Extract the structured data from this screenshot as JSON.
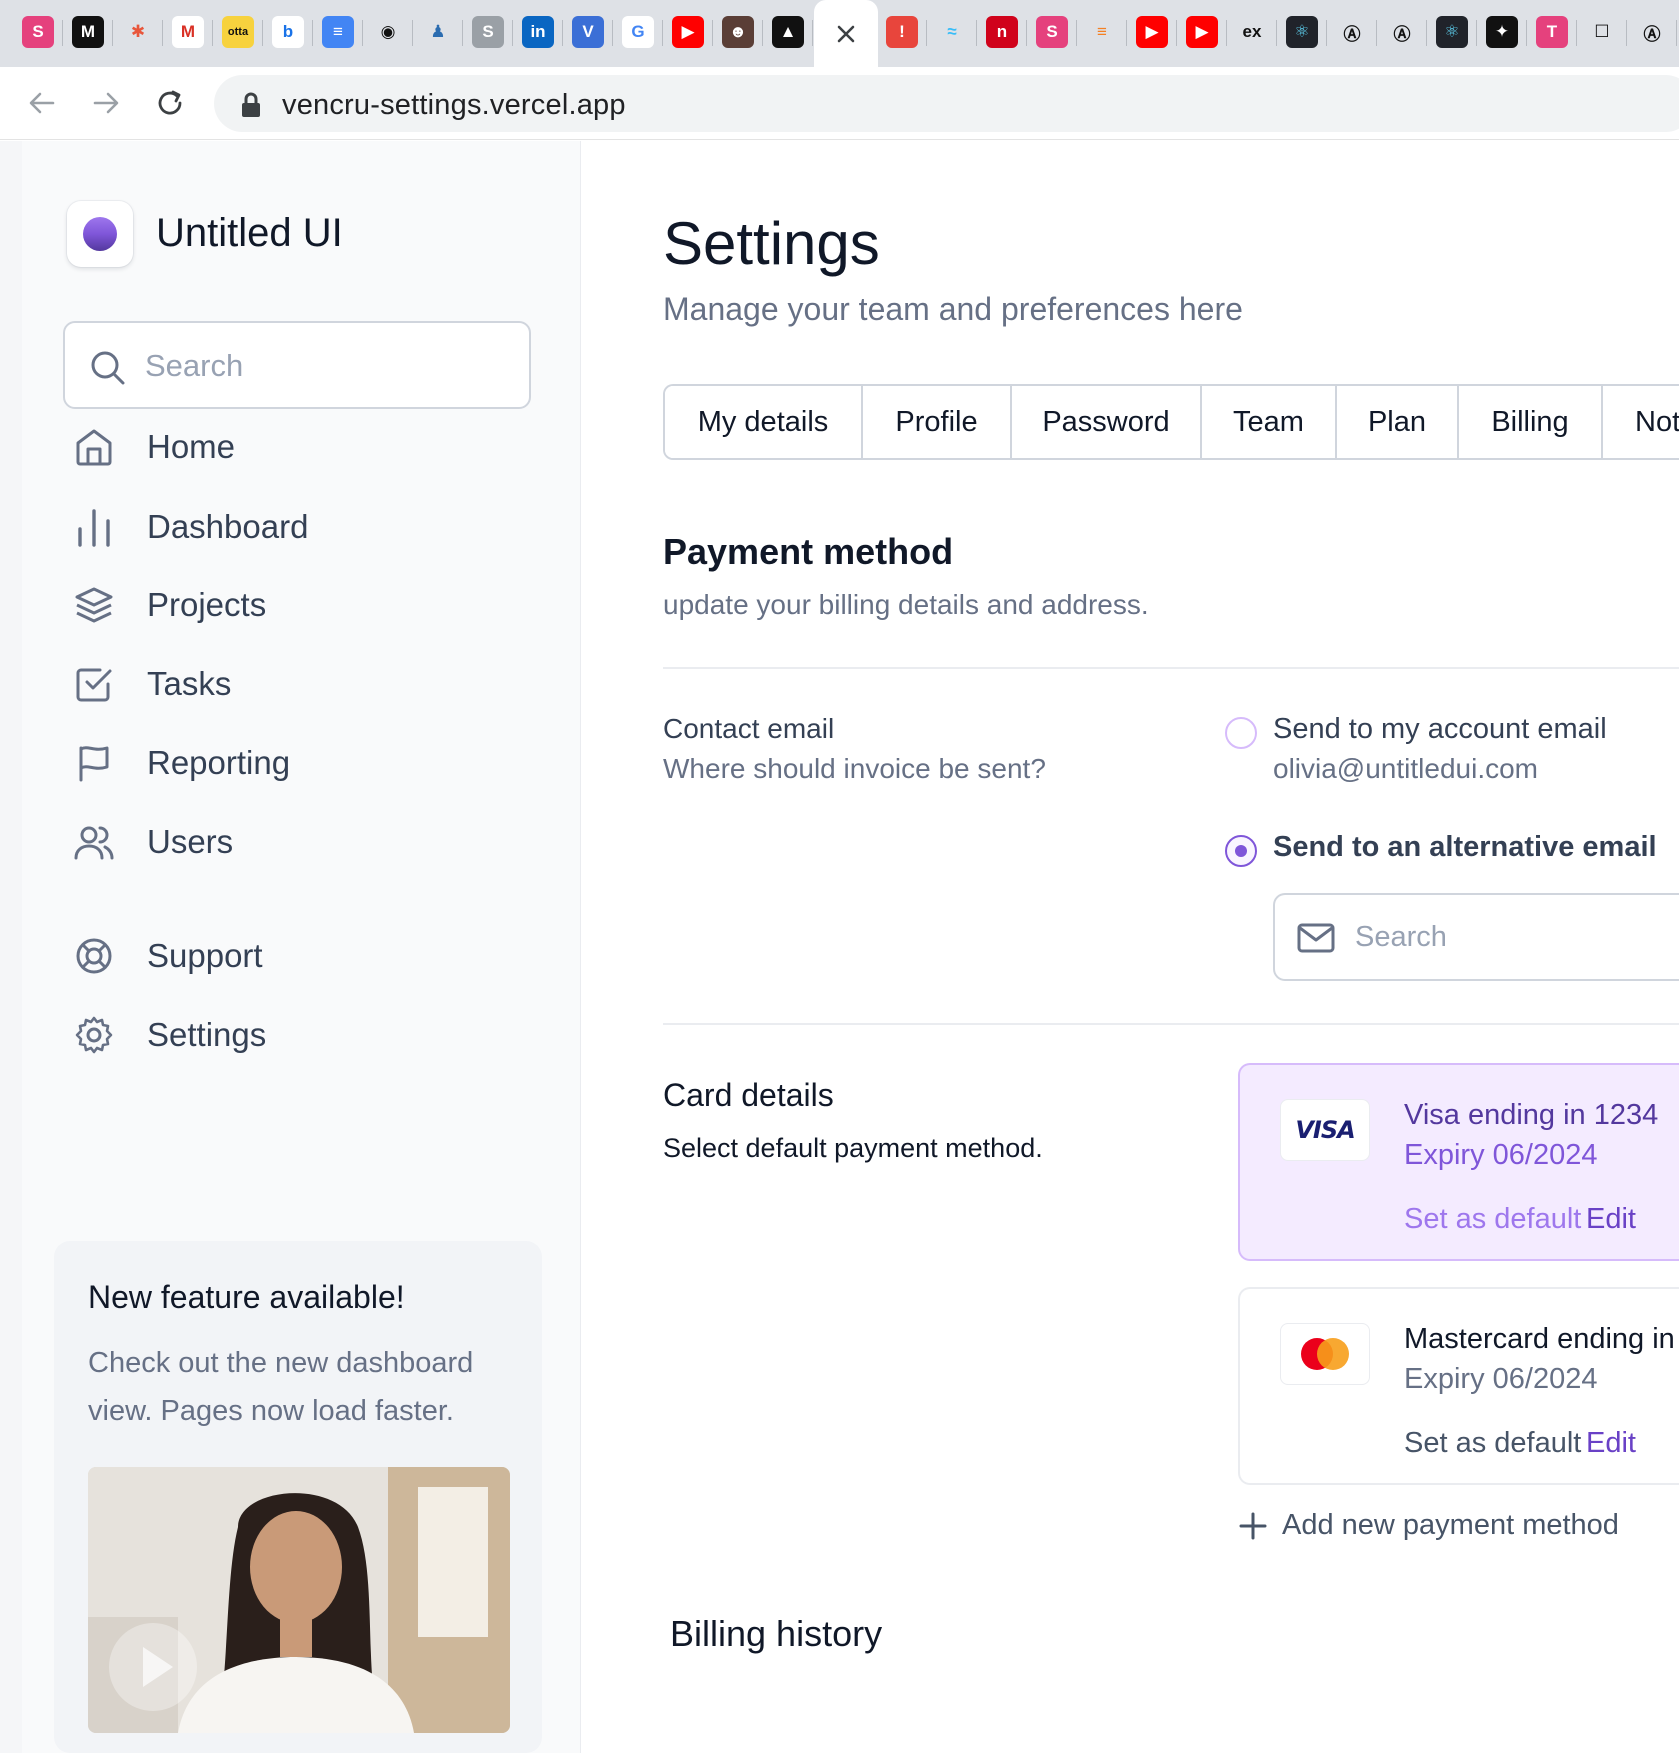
{
  "browser": {
    "url": "vencru-settings.vercel.app",
    "tab_favicons": [
      {
        "icon": "s-icon",
        "glyph": "S",
        "bg": "#e5417d"
      },
      {
        "icon": "medium-icon",
        "glyph": "M",
        "bg": "#111111"
      },
      {
        "icon": "asterisk-icon",
        "glyph": "✱",
        "bg": "#dee1e6",
        "fg": "#e8563b"
      },
      {
        "icon": "gmail-icon",
        "glyph": "M",
        "bg": "#ffffff",
        "fg": "#d93025"
      },
      {
        "icon": "otta-icon",
        "glyph": "otta",
        "bg": "#f7d23e",
        "fg": "#111111"
      },
      {
        "icon": "doc-blue-icon",
        "glyph": "b",
        "bg": "#ffffff",
        "fg": "#1a73e8"
      },
      {
        "icon": "google-docs-icon",
        "glyph": "≡",
        "bg": "#4285f4"
      },
      {
        "icon": "github-icon",
        "glyph": "◉",
        "bg": "#dee1e6",
        "fg": "#111111"
      },
      {
        "icon": "figure-icon",
        "glyph": "♟",
        "bg": "#dee1e6",
        "fg": "#2b6cb0"
      },
      {
        "icon": "s-gray-icon",
        "glyph": "S",
        "bg": "#9aa0a6"
      },
      {
        "icon": "linkedin-icon",
        "glyph": "in",
        "bg": "#0a66c2"
      },
      {
        "icon": "shield-v-icon",
        "glyph": "V",
        "bg": "#3b6fd6"
      },
      {
        "icon": "google-icon",
        "glyph": "G",
        "bg": "#ffffff",
        "fg": "#4285f4"
      },
      {
        "icon": "youtube-icon",
        "glyph": "▶",
        "bg": "#ff0000"
      },
      {
        "icon": "avatar-icon",
        "glyph": "☻",
        "bg": "#5a3e36"
      },
      {
        "icon": "triangle-icon",
        "glyph": "▲",
        "bg": "#111111"
      }
    ],
    "tab_favicons_right": [
      {
        "icon": "alert-icon",
        "glyph": "!",
        "bg": "#e8453c"
      },
      {
        "icon": "tailwind-icon",
        "glyph": "≈",
        "bg": "#dee1e6",
        "fg": "#38bdf8"
      },
      {
        "icon": "n-red-icon",
        "glyph": "n",
        "bg": "#d0021b"
      },
      {
        "icon": "s-pink-icon",
        "glyph": "S",
        "bg": "#e5417d"
      },
      {
        "icon": "stackoverflow-icon",
        "glyph": "≡",
        "bg": "#dee1e6",
        "fg": "#f48024"
      },
      {
        "icon": "youtube-icon",
        "glyph": "▶",
        "bg": "#ff0000"
      },
      {
        "icon": "youtube-icon",
        "glyph": "▶",
        "bg": "#ff0000"
      },
      {
        "icon": "ex-icon",
        "glyph": "ex",
        "bg": "#dee1e6",
        "fg": "#111111"
      },
      {
        "icon": "react-icon",
        "glyph": "⚛",
        "bg": "#20232a",
        "fg": "#61dafb"
      },
      {
        "icon": "a-circle-icon",
        "glyph": "Ⓐ",
        "bg": "#dee1e6",
        "fg": "#111111"
      },
      {
        "icon": "a-circle-icon",
        "glyph": "Ⓐ",
        "bg": "#dee1e6",
        "fg": "#111111"
      },
      {
        "icon": "react-icon",
        "glyph": "⚛",
        "bg": "#20232a",
        "fg": "#61dafb"
      },
      {
        "icon": "star-badge-icon",
        "glyph": "✦",
        "bg": "#111111"
      },
      {
        "icon": "t-icon",
        "glyph": "T",
        "bg": "#e5417d"
      },
      {
        "icon": "square-icon",
        "glyph": "☐",
        "bg": "#dee1e6",
        "fg": "#111111"
      },
      {
        "icon": "a-circle-icon",
        "glyph": "Ⓐ",
        "bg": "#dee1e6",
        "fg": "#111111"
      }
    ]
  },
  "sidebar": {
    "brand": "Untitled UI",
    "search_placeholder": "Search",
    "nav": [
      {
        "label": "Home",
        "icon": "home-icon"
      },
      {
        "label": "Dashboard",
        "icon": "bar-chart-icon"
      },
      {
        "label": "Projects",
        "icon": "layers-icon"
      },
      {
        "label": "Tasks",
        "icon": "check-square-icon"
      },
      {
        "label": "Reporting",
        "icon": "flag-icon"
      },
      {
        "label": "Users",
        "icon": "users-icon"
      }
    ],
    "footer_nav": [
      {
        "label": "Support",
        "icon": "life-buoy-icon"
      },
      {
        "label": "Settings",
        "icon": "gear-icon"
      }
    ],
    "feature": {
      "title": "New feature available!",
      "text": "Check out the new dashboard view. Pages now load faster."
    }
  },
  "main": {
    "title": "Settings",
    "subtitle": "Manage your team and preferences here",
    "tabs": [
      "My details",
      "Profile",
      "Password",
      "Team",
      "Plan",
      "Billing",
      "Not"
    ],
    "payment": {
      "title": "Payment method",
      "subtitle": "update your billing details and address."
    },
    "contact": {
      "label": "Contact email",
      "help": "Where should invoice be sent?",
      "options": [
        {
          "label": "Send to my account email",
          "sub": "olivia@untitledui.com",
          "checked": false
        },
        {
          "label": "Send to an alternative email",
          "checked": true
        }
      ],
      "email_placeholder": "Search"
    },
    "card_details": {
      "label": "Card details",
      "help": "Select default payment method.",
      "cards": [
        {
          "brand_text": "VISA",
          "name": "Visa ending in 1234",
          "expiry": "Expiry 06/2024",
          "set_default": "Set as default",
          "edit": "Edit",
          "selected": true
        },
        {
          "brand_text": "",
          "name": "Mastercard ending in",
          "expiry": "Expiry 06/2024",
          "set_default": "Set as default",
          "edit": "Edit",
          "selected": false
        }
      ],
      "add_label": "Add new payment method"
    },
    "billing_history": {
      "title": "Billing history"
    }
  },
  "colors": {
    "accent": "#7f56d9",
    "accent_dark": "#6941c6",
    "selected_card_bg": "#f4ebff",
    "text_primary": "#101828",
    "text_muted": "#667085"
  }
}
